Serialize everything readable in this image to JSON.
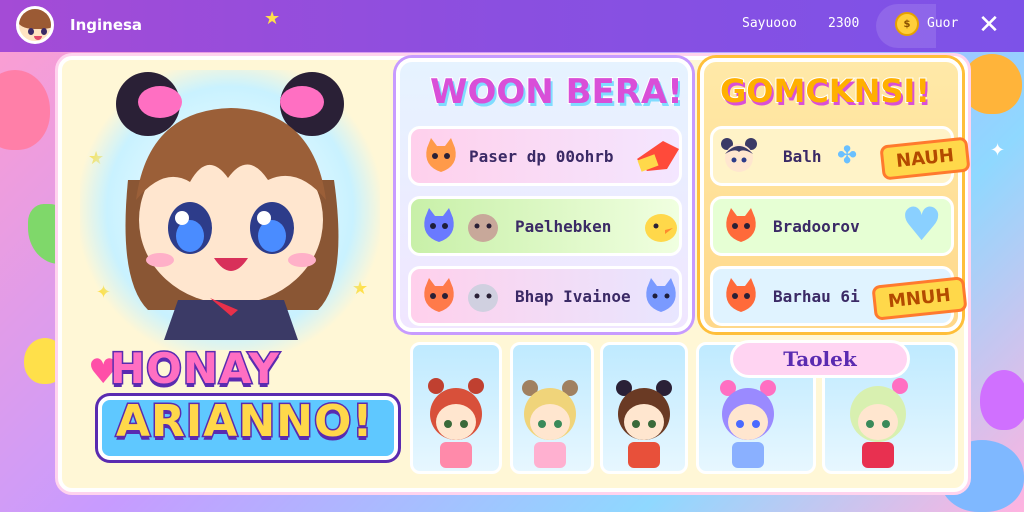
{
  "topbar": {
    "player_name": "Inginesa",
    "stat_1": "Sayuooo",
    "stat_2": "2300",
    "coin_label": "Guor",
    "coin_icon": "coin-icon",
    "close_icon": "close-icon"
  },
  "hero": {
    "title_line_1": "HONAY",
    "title_line_2": "ARIANNO!"
  },
  "left_panel": {
    "title": "WOON BERA!",
    "rows": [
      {
        "label": "Paser dp 00ohrb",
        "pet": "orange-cat-icon",
        "prize_icon": "red-candy-icon"
      },
      {
        "label": "Paelhebken",
        "pet": "blue-cat-icon",
        "prize_icon": "yellow-chick-icon"
      },
      {
        "label": "Bhap Ivainoe",
        "pet": "orange-cat-icon",
        "prize_icon": "blue-creature-icon"
      }
    ]
  },
  "right_panel": {
    "title": "GOMCKNSI!",
    "rows": [
      {
        "label": "Balh",
        "badge": "NAUH",
        "pet": "girl-avatar-icon",
        "prize_icon": "clover-icon"
      },
      {
        "label": "Bradoorov",
        "badge": "",
        "pet": "red-cat-icon",
        "prize_icon": "blue-heart-icon"
      },
      {
        "label": "Barhau 6i",
        "badge": "MNUH",
        "pet": "red-cat-icon",
        "prize_icon": ""
      }
    ]
  },
  "roster": {
    "title": "Taolek",
    "characters": [
      {
        "name": "red-hair-girl",
        "hair": "#d8503a"
      },
      {
        "name": "blonde-girl",
        "hair": "#f0d47a"
      },
      {
        "name": "brown-hair-girl",
        "hair": "#6a3a24"
      },
      {
        "name": "lavender-hair-girl",
        "hair": "#9a8aff"
      },
      {
        "name": "green-hair-girl",
        "hair": "#d8f0b0"
      }
    ]
  },
  "colors": {
    "topbar": "#8a4fe0",
    "frame": "#fff7d6",
    "accent_pink": "#ff6fc2",
    "accent_yellow": "#ffd84a",
    "outline_purple": "#5a2bb0"
  }
}
